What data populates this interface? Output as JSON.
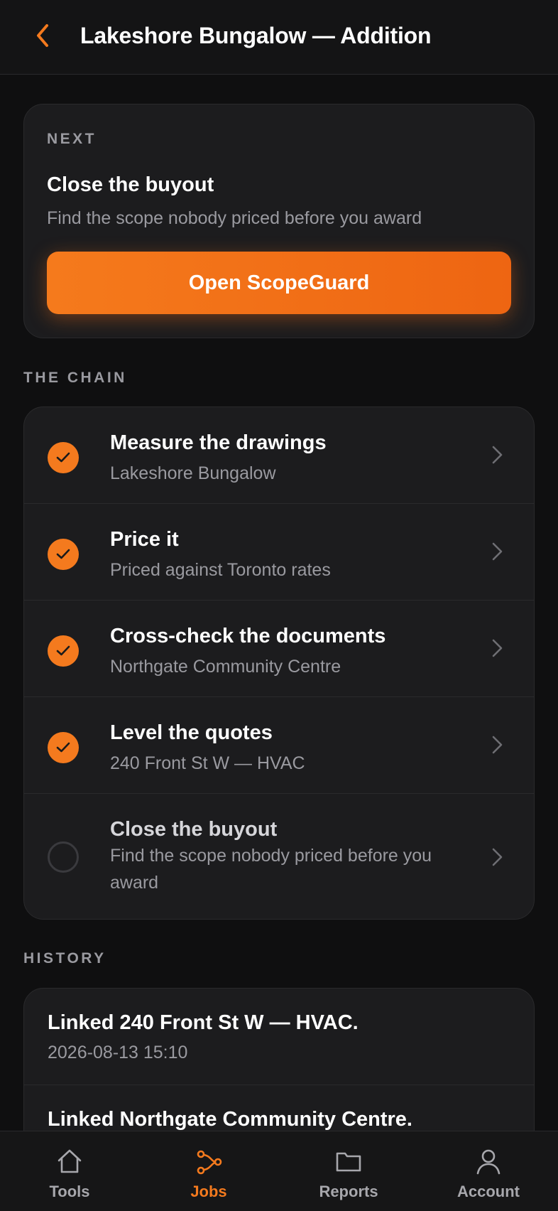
{
  "header": {
    "title": "Lakeshore Bungalow — Addition",
    "back_icon": "chevron-left-icon"
  },
  "next": {
    "eyebrow": "NEXT",
    "title": "Close the buyout",
    "subtitle": "Find the scope nobody priced before you award",
    "cta_label": "Open ScopeGuard"
  },
  "chain": {
    "label": "THE CHAIN",
    "steps": [
      {
        "title": "Measure the drawings",
        "subtitle": "Lakeshore Bungalow",
        "done": true
      },
      {
        "title": "Price it",
        "subtitle": "Priced against Toronto rates",
        "done": true
      },
      {
        "title": "Cross-check the documents",
        "subtitle": "Northgate Community Centre",
        "done": true
      },
      {
        "title": "Level the quotes",
        "subtitle": "240 Front St W — HVAC",
        "done": true
      },
      {
        "title": "Close the buyout",
        "subtitle": "Find the scope nobody priced before you award",
        "done": false
      }
    ]
  },
  "history": {
    "label": "HISTORY",
    "items": [
      {
        "title": "Linked 240 Front St W — HVAC.",
        "time": "2026-08-13 15:10"
      },
      {
        "title": "Linked Northgate Community Centre.",
        "time": ""
      }
    ]
  },
  "tabs": [
    {
      "label": "Tools",
      "icon": "home-icon",
      "active": false
    },
    {
      "label": "Jobs",
      "icon": "chain-nodes-icon",
      "active": true
    },
    {
      "label": "Reports",
      "icon": "folder-icon",
      "active": false
    },
    {
      "label": "Account",
      "icon": "person-icon",
      "active": false
    }
  ],
  "colors": {
    "accent": "#f47a1e",
    "background": "#0f0f10",
    "card": "#1c1c1e",
    "muted_text": "#9a9aa0"
  }
}
